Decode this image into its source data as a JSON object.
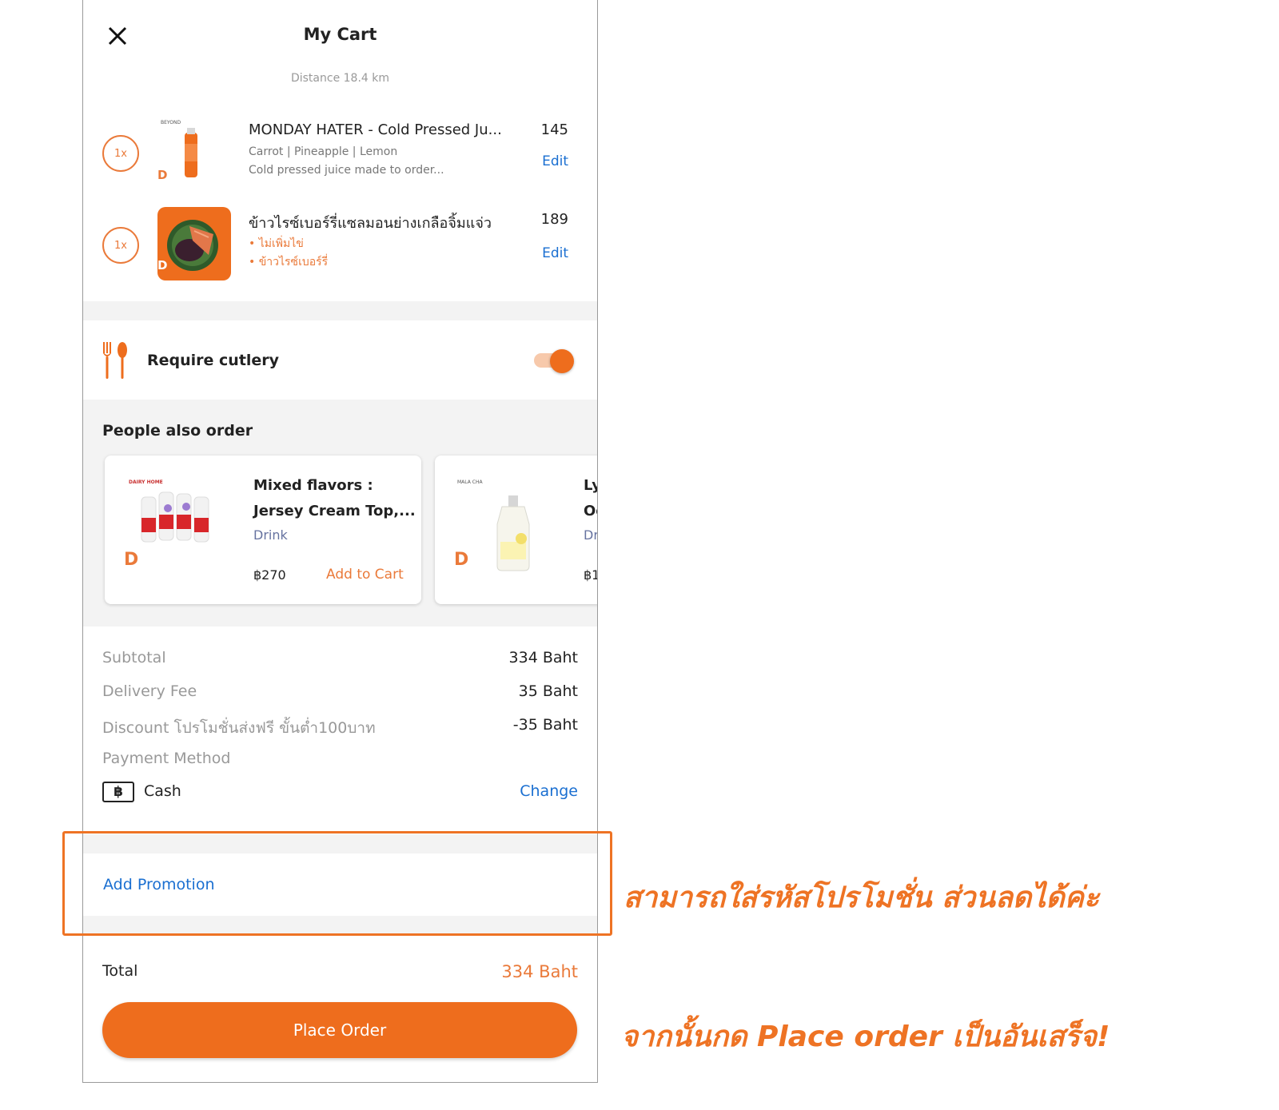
{
  "header": {
    "title": "My Cart",
    "distance": "Distance 18.4 km"
  },
  "cart_items": [
    {
      "qty": "1x",
      "name": "MONDAY HATER - Cold Pressed Ju...",
      "details": [
        "Carrot | Pineapple | Lemon",
        "Cold pressed juice made to order..."
      ],
      "price": "145",
      "edit_label": "Edit",
      "badge": "D",
      "brand_text": "BEYOND"
    },
    {
      "qty": "1x",
      "name": "ข้าวไรซ์เบอร์รี่แซลมอนย่างเกลือจิ้มแจ่ว",
      "options": [
        "• ไม่เพิ่มไข่",
        "• ข้าวไรซ์เบอร์รี่"
      ],
      "price": "189",
      "edit_label": "Edit",
      "badge": "D"
    }
  ],
  "cutlery": {
    "label": "Require cutlery",
    "enabled": true
  },
  "people_also_order": {
    "title": "People also order",
    "cards": [
      {
        "name_line1": "Mixed flavors :",
        "name_line2": "Jersey Cream Top,...",
        "category": "Drink",
        "price": "฿270",
        "add_label": "Add to Cart",
        "badge": "D",
        "brand_text": "DAIRY HOME"
      },
      {
        "name_line1": "Ly",
        "name_line2": "Oc",
        "category": "Dr",
        "price": "฿1",
        "badge": "D",
        "brand_text": "MALA CHA"
      }
    ]
  },
  "summary": {
    "subtotal_label": "Subtotal",
    "subtotal_value": "334 Baht",
    "delivery_label": "Delivery Fee",
    "delivery_value": "35 Baht",
    "discount_label": "Discount โปรโมชั่นส่งฟรี ขั้นต่ำ100บาท",
    "discount_value": "-35 Baht",
    "payment_label": "Payment Method",
    "payment_icon": "฿",
    "payment_method": "Cash",
    "change_label": "Change"
  },
  "promotion": {
    "label": "Add Promotion"
  },
  "total": {
    "label": "Total",
    "value": "334 Baht"
  },
  "place_order": {
    "label": "Place Order"
  },
  "annotations": {
    "promo_note": "สามารถใส่รหัสโปรโมชั่น ส่วนลดได้ค่ะ",
    "order_note": "จากนั้นกด Place order เป็นอันเสร็จ!"
  },
  "colors": {
    "accent": "#ee6d1d",
    "link": "#1a6fd1",
    "annotation": "#ee7324"
  }
}
